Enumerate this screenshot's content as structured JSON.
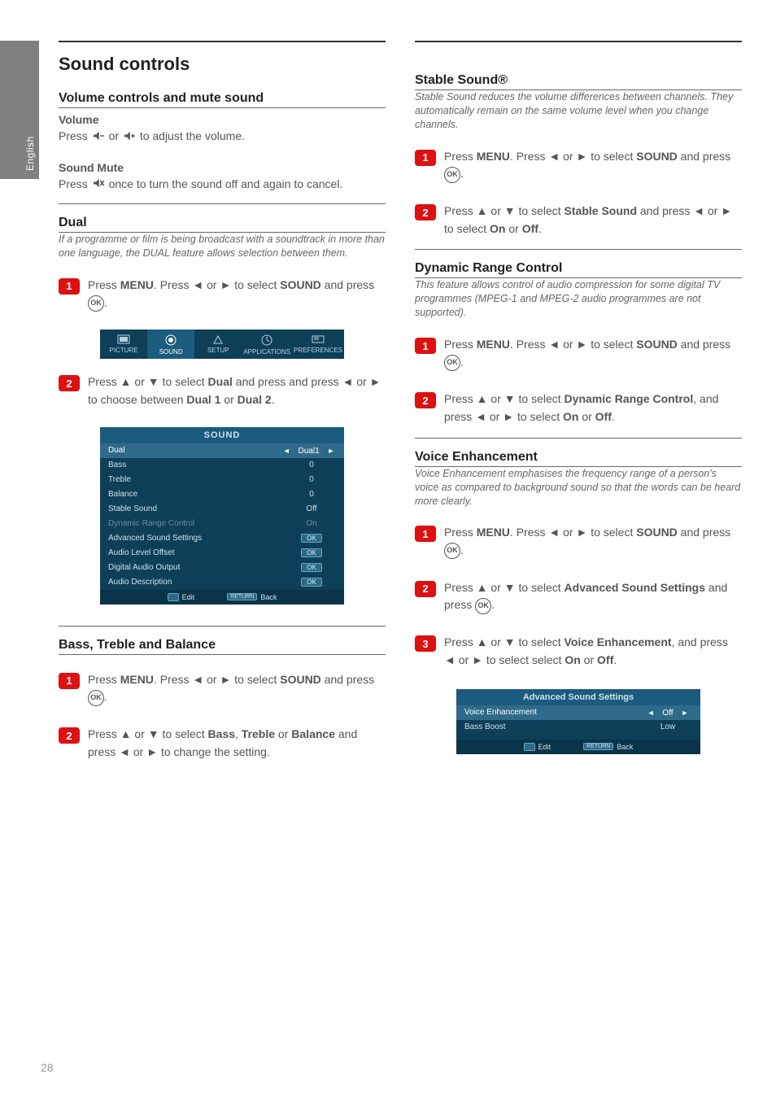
{
  "side_tab": "English",
  "page_number": "28",
  "main_heading": "Sound controls",
  "left": {
    "vol_head": "Volume controls and mute sound",
    "vol_title": "Volume",
    "vol_body_a": "Press ",
    "vol_body_b": " or ",
    "vol_body_c": " to adjust the volume.",
    "mute_title": "Sound Mute",
    "mute_body_a": "Press ",
    "mute_body_b": " once to turn the sound off and again to cancel.",
    "dual_head": "Dual",
    "dual_cap": "If a programme or film is being broadcast with a soundtrack in more than one language, the DUAL feature allows selection between them.",
    "dual_step1_a": "Press ",
    "dual_step1_b": ". Press ◄ or ► to select ",
    "dual_step1_c": " and press ",
    "dual_step1_d": ".",
    "dual_step2_a": "Press ▲ or ▼ to select ",
    "dual_step2_b": " and press ◄ or ► to choose between ",
    "dual_step2_c": " or ",
    "dual_step2_d": ".",
    "menu_word": "MENU",
    "sound_word": "SOUND",
    "dual_word": "Dual",
    "dual1": "Dual 1",
    "dual2": "Dual 2",
    "osd": {
      "tabs": [
        "PICTURE",
        "SOUND",
        "SETUP",
        "APPLICATIONS",
        "PREFERENCES"
      ],
      "title": "SOUND",
      "rows": [
        {
          "label": "Dual",
          "value": "Dual1",
          "type": "sel"
        },
        {
          "label": "Bass",
          "value": "0",
          "type": "plain"
        },
        {
          "label": "Treble",
          "value": "0",
          "type": "plain"
        },
        {
          "label": "Balance",
          "value": "0",
          "type": "plain"
        },
        {
          "label": "Stable Sound",
          "value": "Off",
          "type": "plain"
        },
        {
          "label": "Dynamic Range Control",
          "value": "On",
          "type": "dim"
        },
        {
          "label": "Advanced Sound Settings",
          "value": "OK",
          "type": "ok"
        },
        {
          "label": "Audio Level Offset",
          "value": "OK",
          "type": "ok"
        },
        {
          "label": "Digital Audio Output",
          "value": "OK",
          "type": "ok"
        },
        {
          "label": "Audio Description",
          "value": "OK",
          "type": "ok"
        }
      ],
      "foot_edit": "Edit",
      "foot_return": "RETURN",
      "foot_back": "Back"
    },
    "btb_head": "Bass, Treble and Balance",
    "btb_step1_a": "Press ",
    "btb_step1_b": ". Press ◄ or ► to select ",
    "btb_step1_c": " and press ",
    "btb_step1_d": ".",
    "btb_step2_a": "Press ▲ or ▼ to select ",
    "btb_step2_bass": "Bass",
    "btb_step2_treble": "Treble",
    "btb_step2_balance": "Balance",
    "btb_step2_b": " and press ◄ or ► to change the setting.",
    "btb_step2_sep1": ", ",
    "btb_step2_sep2": " or "
  },
  "right": {
    "stable_head": "Stable Sound®",
    "stable_cap": "Stable Sound reduces the volume differences between channels. They automatically remain on the same volume level when you change channels.",
    "stable_step1_a": "Press ",
    "stable_step1_b": ". Press ◄ or ► to select ",
    "stable_step1_c": " and press ",
    "stable_step1_d": ".",
    "stable_step2_a": "Press ▲ or ▼ to select ",
    "stable_word": "Stable Sound",
    "stable_step2_b": " and press ◄ or ► to select ",
    "stable_on": "On",
    "stable_or": " or ",
    "stable_off": "Off",
    "stable_step2_c": ".",
    "drc_head": "Dynamic Range Control",
    "drc_cap": "This feature allows control of audio compression for some digital TV programmes (MPEG-1 and MPEG-2 audio programmes are not supported).",
    "drc_step1_a": "Press ",
    "drc_step1_b": ". Press ◄ or ► to select ",
    "drc_step1_c": " and press ",
    "drc_step1_d": ".",
    "drc_step2_a": "Press ▲ or ▼ to select ",
    "drc_word": "Dynamic Range Control",
    "drc_step2_b": ", and press ◄ or ► to select ",
    "drc_on": "On",
    "drc_or": " or ",
    "drc_off": "Off",
    "drc_step2_c": ".",
    "ve_head": "Voice Enhancement",
    "ve_cap": "Voice Enhancement emphasises the frequency range of a person's voice as compared to background sound so that the words can be heard more clearly.",
    "ve_step1_a": "Press ",
    "ve_step1_b": ". Press ◄ or ► to select ",
    "ve_step1_c": " and press ",
    "ve_step1_d": ".",
    "ve_step2_a": "Press ▲ or ▼ to select ",
    "ve_adv_word": "Advanced Sound Settings",
    "ve_step2_b": " and press ",
    "ve_step2_c": ".",
    "ve_step3_a": "Press ▲ or ▼ to select ",
    "ve_word": "Voice Enhancement",
    "ve_step3_b": ", and press ◄ or ► to select ",
    "ve_on": "On",
    "ve_or": " or ",
    "ve_off": "Off",
    "ve_step3_c": ".",
    "osd2": {
      "title": "Advanced Sound Settings",
      "rows": [
        {
          "label": "Voice Enhancement",
          "value": "Off",
          "type": "sel"
        },
        {
          "label": "Bass Boost",
          "value": "Low",
          "type": "plain"
        }
      ],
      "foot_edit": "Edit",
      "foot_return": "RETURN",
      "foot_back": "Back"
    }
  }
}
